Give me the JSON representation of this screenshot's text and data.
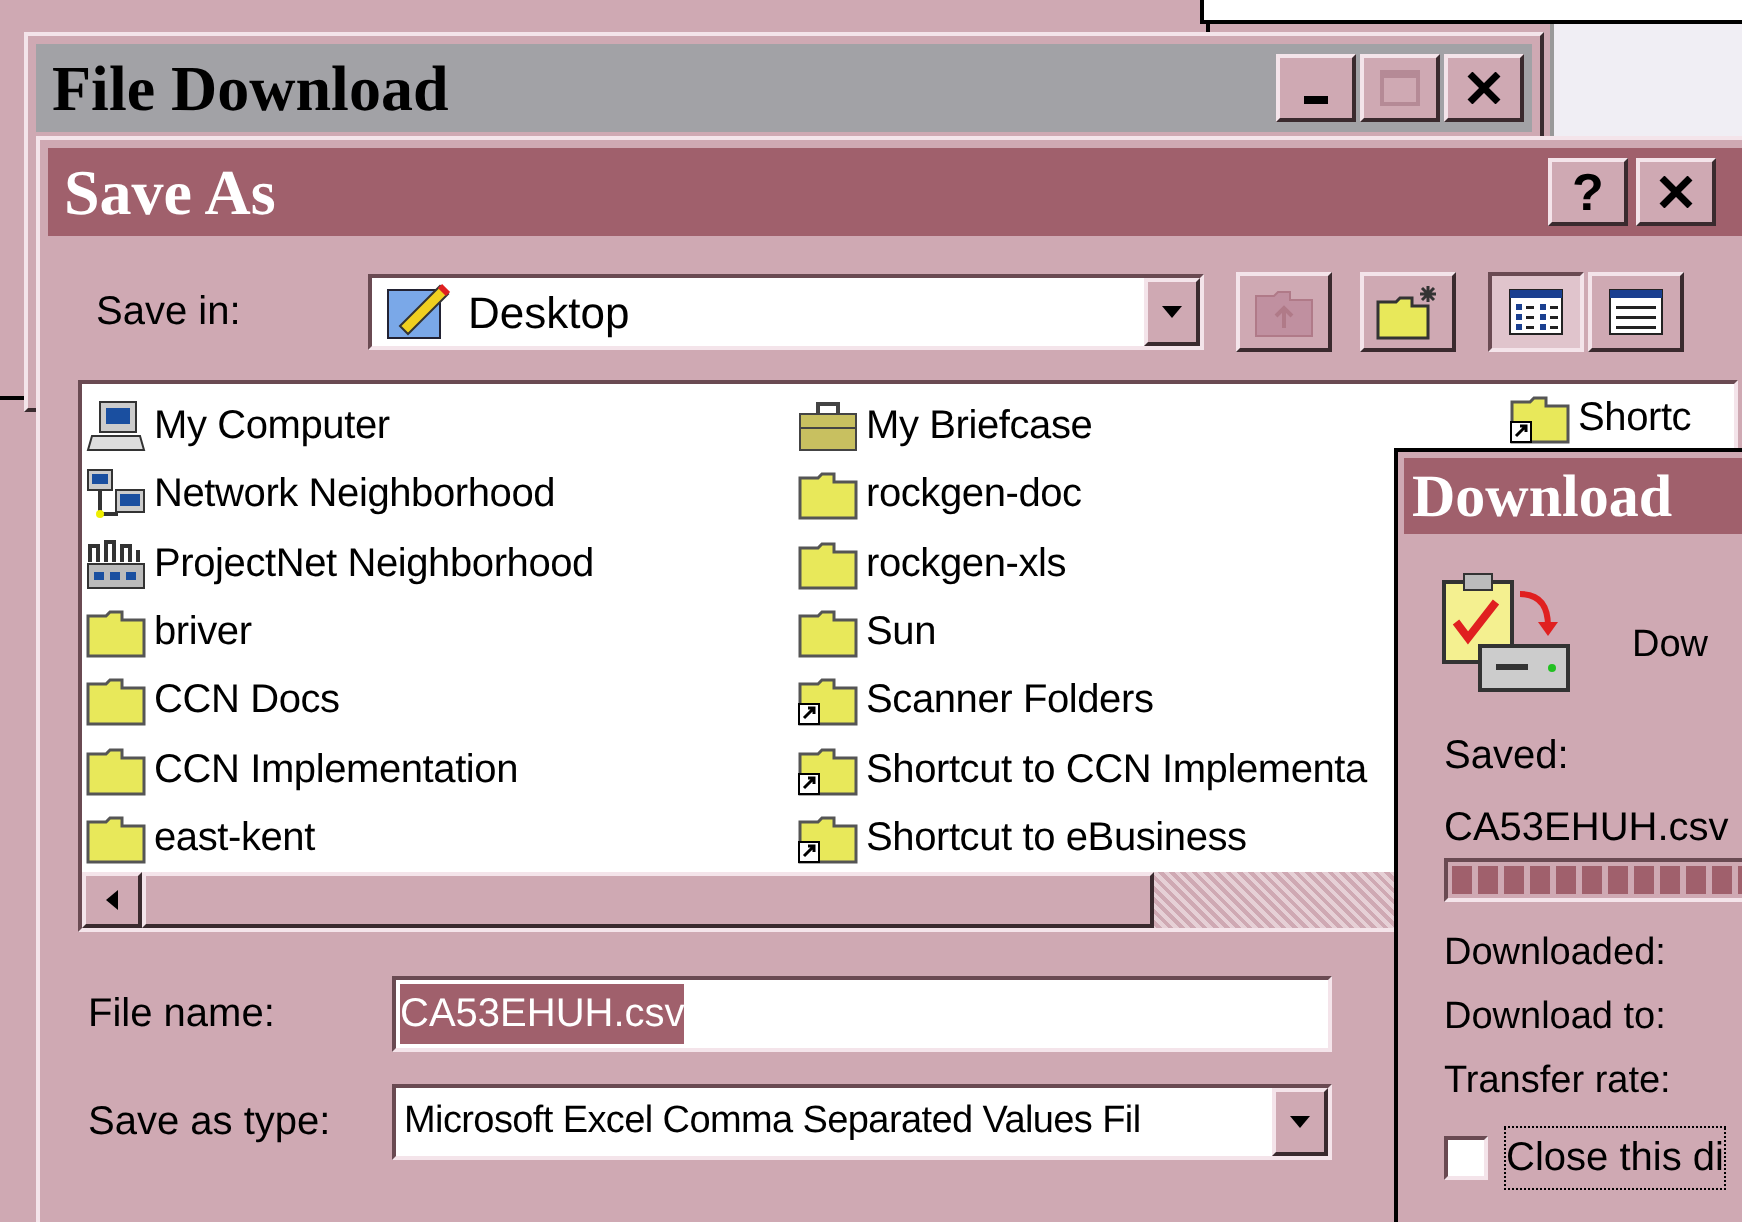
{
  "file_download": {
    "title": "File Download",
    "buttons": [
      {
        "kind": "minimize"
      },
      {
        "kind": "maximize",
        "disabled": true
      },
      {
        "kind": "close"
      }
    ]
  },
  "save_as": {
    "title": "Save As",
    "help": "?",
    "save_in": {
      "label": "Save in:",
      "value": "Desktop"
    },
    "toolbar": [
      {
        "kind": "up",
        "disabled": true
      },
      {
        "kind": "new-folder"
      },
      {
        "kind": "list",
        "selected": true
      },
      {
        "kind": "details",
        "selected": false
      }
    ],
    "columns": [
      [
        {
          "name": "My Computer",
          "kind": "computer"
        },
        {
          "name": "Network Neighborhood",
          "kind": "network"
        },
        {
          "name": "ProjectNet Neighborhood",
          "kind": "projectnet"
        },
        {
          "name": "briver",
          "kind": "folder"
        },
        {
          "name": "CCN Docs",
          "kind": "folder"
        },
        {
          "name": "CCN Implementation",
          "kind": "folder"
        },
        {
          "name": "east-kent",
          "kind": "folder"
        }
      ],
      [
        {
          "name": "My Briefcase",
          "kind": "briefcase"
        },
        {
          "name": "rockgen-doc",
          "kind": "folder"
        },
        {
          "name": "rockgen-xls",
          "kind": "folder"
        },
        {
          "name": "Sun",
          "kind": "folder"
        },
        {
          "name": "Scanner Folders",
          "kind": "shortcut"
        },
        {
          "name": "Shortcut to CCN Implementa",
          "kind": "shortcut"
        },
        {
          "name": "Shortcut to eBusiness",
          "kind": "shortcut"
        }
      ],
      [
        {
          "name": "Shortc",
          "kind": "shortcut"
        }
      ]
    ],
    "file_name": {
      "label": "File name:",
      "value": "CA53EHUH.csv"
    },
    "save_as_type": {
      "label": "Save as type:",
      "value": "Microsoft Excel Comma Separated Values Fil"
    }
  },
  "download": {
    "title": "Download",
    "status": "Dow",
    "saved_label": "Saved:",
    "file": "CA53EHUH.csv",
    "level": 1,
    "fields": [
      "Downloaded:",
      "Download to:",
      "Transfer rate:"
    ],
    "close_when_done": {
      "label": "Close this di",
      "checked": false
    }
  }
}
